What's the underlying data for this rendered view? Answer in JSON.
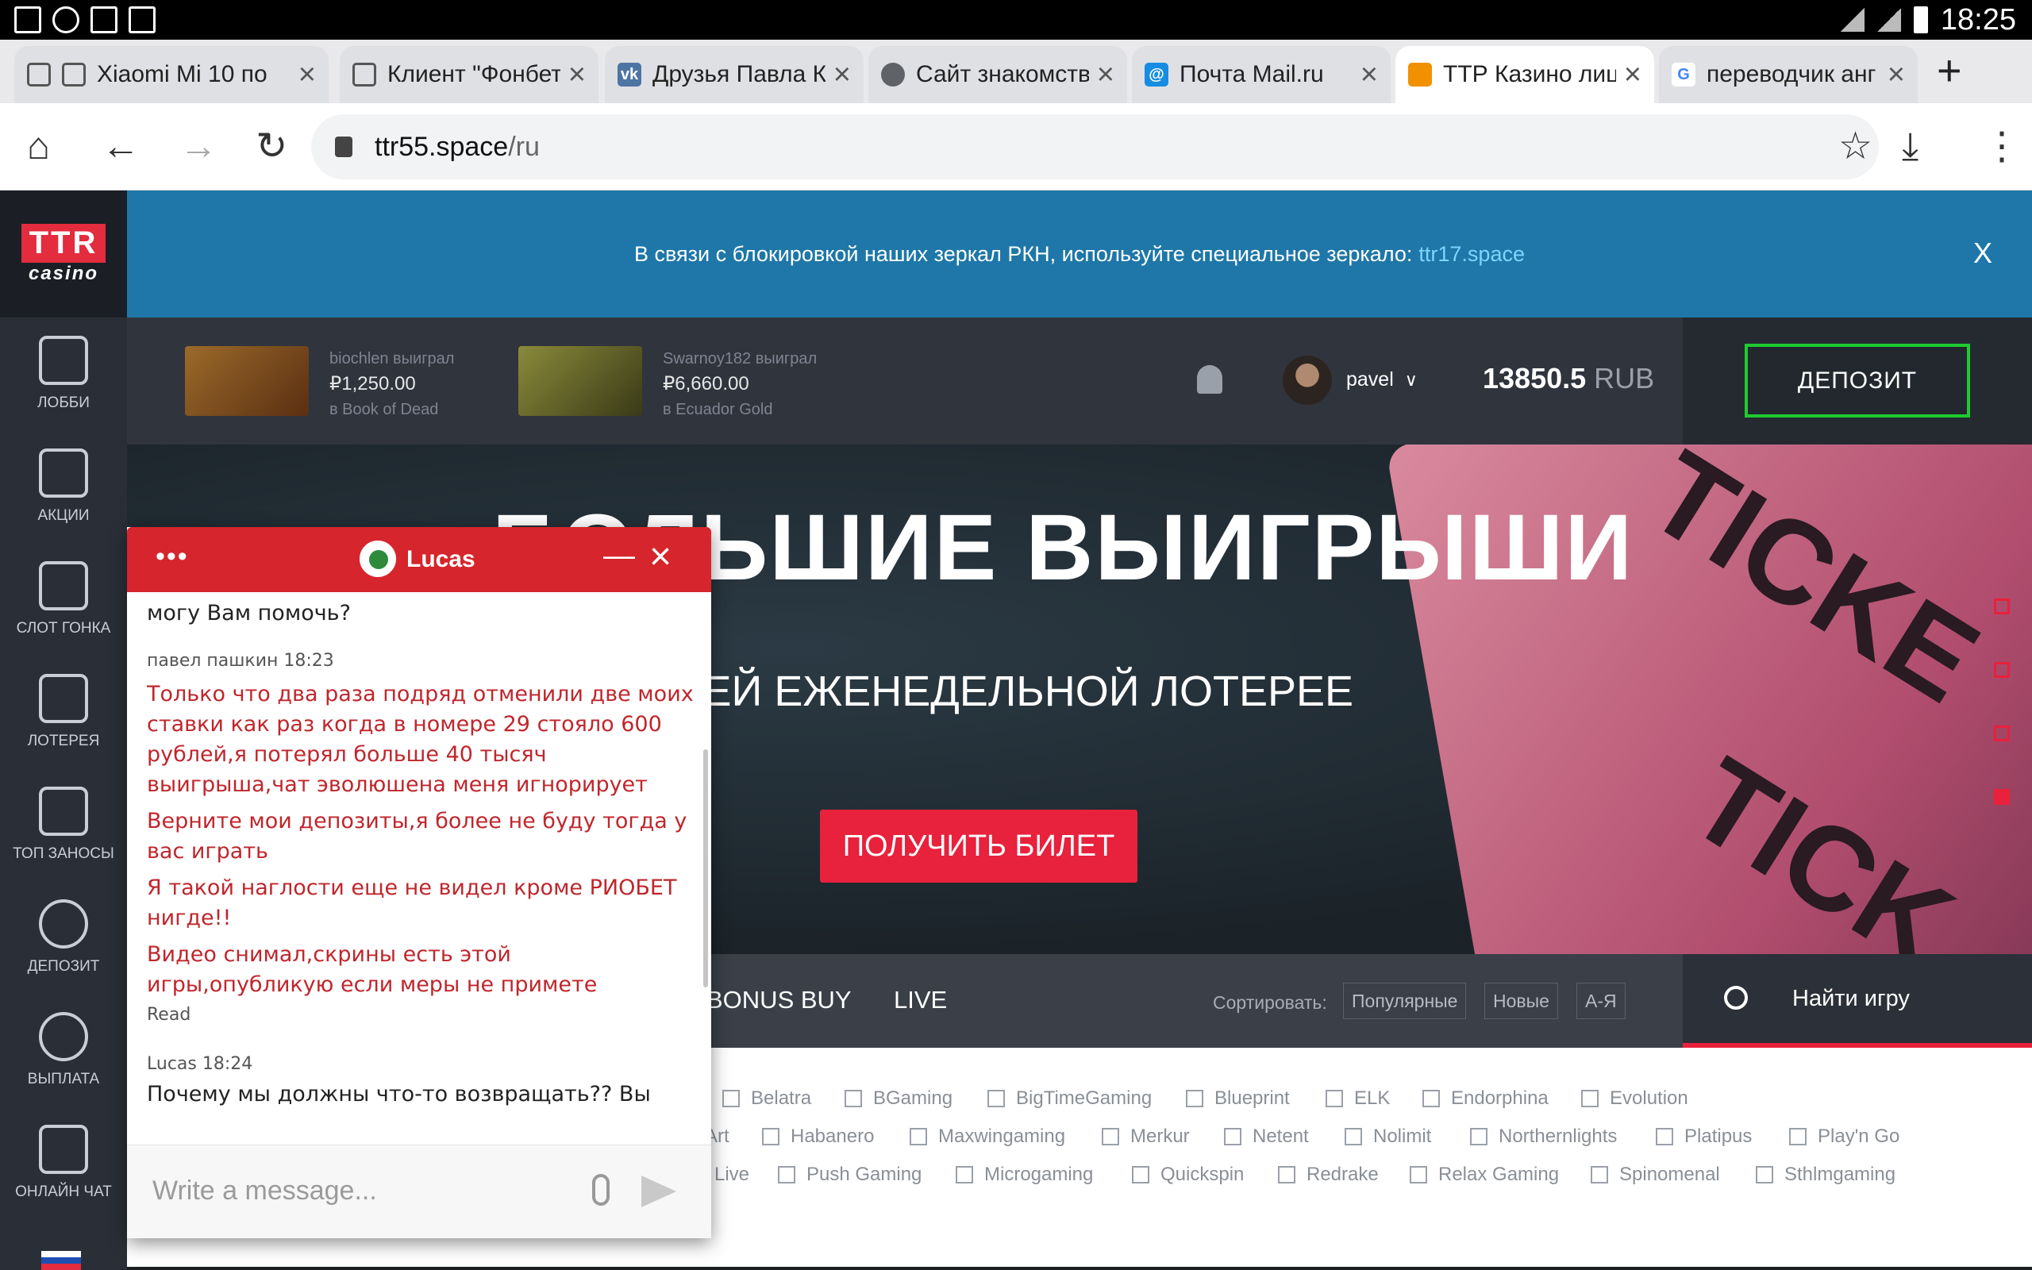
{
  "status": {
    "time": "18:25"
  },
  "tabs": [
    {
      "title": "Xiaomi Mi 10 по",
      "icon": "page-icon",
      "color": "#9aa0a6"
    },
    {
      "title": "Клиент \"Фонбет",
      "icon": "page-icon",
      "color": "#9aa0a6"
    },
    {
      "title": "Друзья Павла К",
      "icon": "vk-icon",
      "color": "#4c75a3"
    },
    {
      "title": "Сайт знакомств",
      "icon": "globe-icon",
      "color": "#5f6368"
    },
    {
      "title": "Почта Mail.ru",
      "icon": "mailru-icon",
      "color": "#168de2"
    },
    {
      "title": "ТТР Казино лиц",
      "icon": "ttr-icon",
      "color": "#f29100"
    },
    {
      "title": "переводчик анг",
      "icon": "google-icon",
      "color": "#4285f4"
    }
  ],
  "address": {
    "domain": "ttr55.space",
    "path": "/ru"
  },
  "sidebar": {
    "logo_top": "TTR",
    "logo_bottom": "casino",
    "items": [
      {
        "label": "ЛОББИ",
        "icon": "slot-machine-icon"
      },
      {
        "label": "АКЦИИ",
        "icon": "gift-icon"
      },
      {
        "label": "СЛОТ ГОНКА",
        "icon": "race-flag-icon"
      },
      {
        "label": "ЛОТЕРЕЯ",
        "icon": "lottery-icon"
      },
      {
        "label": "ТОП ЗАНОСЫ",
        "icon": "podium-icon"
      },
      {
        "label": "ДЕПОЗИТ",
        "icon": "deposit-coins-icon"
      },
      {
        "label": "ВЫПЛАТА",
        "icon": "payout-coins-icon"
      },
      {
        "label": "ОНЛАЙН ЧАТ",
        "icon": "chat-bubble-icon"
      }
    ]
  },
  "notice": {
    "text": "В связи с блокировкой наших зеркал РКН, используйте специальное зеркало:",
    "mirror": "ttr17.space",
    "close": "X"
  },
  "header": {
    "wins": [
      {
        "user": "biochlen выиграл",
        "amount": "₽1,250.00",
        "game": "в Book of Dead",
        "thumb": "#7a4a1c"
      },
      {
        "user": "Swarnoy182 выиграл",
        "amount": "₽6,660.00",
        "game": "в Ecuador Gold",
        "thumb": "#5b5a26"
      }
    ],
    "username": "pavel",
    "balance_value": "13850.5",
    "balance_currency": "RUB",
    "deposit": "ДЕПОЗИТ"
  },
  "hero": {
    "title": "БОЛЬШИЕ ВЫИГРЫШИ",
    "subtitle": "В НАШЕЙ ЕЖЕНЕДЕЛЬНОЙ ЛОТЕРЕЕ",
    "button": "ПОЛУЧИТЬ БИЛЕТ",
    "ticket_text_1": "TICKE",
    "ticket_text_2": "TICK"
  },
  "gamenav": {
    "links": [
      "BONUS BUY",
      "LIVE"
    ],
    "sort_label": "Сортировать:",
    "sort_options": [
      "Популярные",
      "Новые",
      "А-Я"
    ],
    "search": "Найти игру"
  },
  "providers": [
    [
      "Belatra",
      "BGaming",
      "BigTimeGaming",
      "Blueprint",
      "ELK",
      "Endorphina",
      "Evolution"
    ],
    [
      "Art",
      "Habanero",
      "Maxwingaming",
      "Merkur",
      "Netent",
      "Nolimit",
      "Northernlights",
      "Platipus",
      "Play'n Go"
    ],
    [
      "Live",
      "Push Gaming",
      "Microgaming",
      "Quickspin",
      "Redrake",
      "Relax Gaming",
      "Spinomenal",
      "Sthlmgaming"
    ]
  ],
  "chat": {
    "agent": "Lucas",
    "menu": "•••",
    "messages": {
      "top": "могу Вам помочь?",
      "user_sender": "павел пашкин 18:23",
      "user_msgs": [
        "Только что два раза подряд отменили две моих ставки как раз когда в номере 29 стояло 600 рублей,я потерял больше 40 тысяч выигрыша,чат эволюшена меня игнорирует",
        "Верните мои депозиты,я более не буду тогда у вас играть",
        "Я такой наглости еще не видел кроме РИОБЕТ нигде!!",
        "Видео снимал,скрины есть этой игры,опубликую если меры не примете"
      ],
      "read": "Read",
      "agent_sender": "Lucas 18:24",
      "agent_msg": "Почему мы должны что-то возвращать?? Вы"
    },
    "placeholder": "Write a message..."
  }
}
